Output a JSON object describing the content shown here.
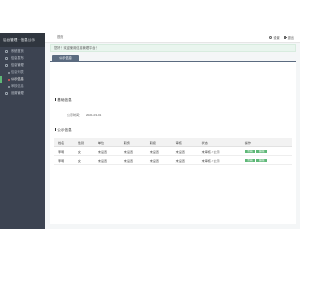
{
  "app": {
    "brand": "后台管理 · 信息公示"
  },
  "sidebar": {
    "items": [
      {
        "label": "系统首页",
        "sub": false,
        "active": false
      },
      {
        "label": "信息发布",
        "sub": false,
        "active": false
      },
      {
        "label": "信息管理",
        "sub": false,
        "active": false
      },
      {
        "label": "信息列表",
        "sub": true,
        "active": false
      },
      {
        "label": "公示信息",
        "sub": true,
        "active": true
      },
      {
        "label": "审核信息",
        "sub": true,
        "active": false
      },
      {
        "label": "设置管理",
        "sub": false,
        "active": false
      }
    ]
  },
  "topbar": {
    "breadcrumb": "首页",
    "settings_label": "设置",
    "exit_label": "退出"
  },
  "notice": "您好！欢迎使用信息管理平台！",
  "tabs": [
    {
      "label": "公示信息"
    }
  ],
  "section_basic": {
    "title": "基础信息",
    "field_label": "公示时间：",
    "field_value": "2021-03-01"
  },
  "section_records": {
    "title": "公示信息",
    "columns": [
      "姓名",
      "性别",
      "单位",
      "职务",
      "职级",
      "审核",
      "状态",
      "操作"
    ],
    "rows": [
      {
        "cells": [
          "李明",
          "女",
          "未设置",
          "未设置",
          "未设置",
          "未设置",
          "未审核 / 公示"
        ],
        "actions": [
          "查看",
          "编辑"
        ]
      },
      {
        "cells": [
          "李明",
          "女",
          "未设置",
          "未设置",
          "未设置",
          "未设置",
          "未审核 / 公示"
        ],
        "actions": [
          "查看",
          "编辑"
        ]
      }
    ]
  },
  "colors": {
    "sidebar": "#3c4351",
    "accent": "#5fb878",
    "tab": "#5b6b80",
    "notice_bg": "#e9f5ee"
  }
}
